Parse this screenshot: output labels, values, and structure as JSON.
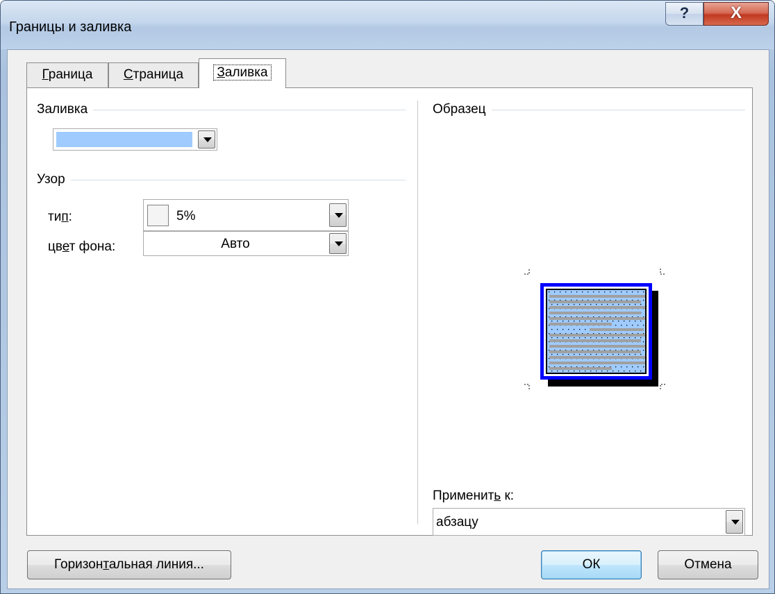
{
  "window": {
    "title": "Границы и заливка",
    "help_label": "?",
    "close_label": "X"
  },
  "tabs": [
    {
      "label": "Граница",
      "accel": "Г",
      "rest": "раница",
      "active": false
    },
    {
      "label": "Страница",
      "accel": "С",
      "rest": "траница",
      "active": false
    },
    {
      "label": "Заливка",
      "accel": "З",
      "rest": "аливка",
      "active": true
    }
  ],
  "fill": {
    "group_label": "Заливка",
    "selected_color": "#9fcbff"
  },
  "pattern": {
    "group_label": "Узор",
    "type_label_pre": "ти",
    "type_label_accel": "п",
    "type_label_post": ":",
    "type_value": "5%",
    "bg_label_pre": "цв",
    "bg_label_accel": "е",
    "bg_label_post": "т фона:",
    "bg_value": "Авто"
  },
  "preview": {
    "group_label": "Образец",
    "border_color": "#0000ff",
    "fill_color": "#9fcbff",
    "text_bar_color": "#a0a0a0"
  },
  "apply": {
    "label_pre": "Применит",
    "label_accel": "ь",
    "label_post": " к:",
    "value": "абзацу"
  },
  "buttons": {
    "horizontal_line_pre": "Горизон",
    "horizontal_line_accel": "т",
    "horizontal_line_post": "альная линия...",
    "ok": "ОК",
    "cancel": "Отмена"
  }
}
